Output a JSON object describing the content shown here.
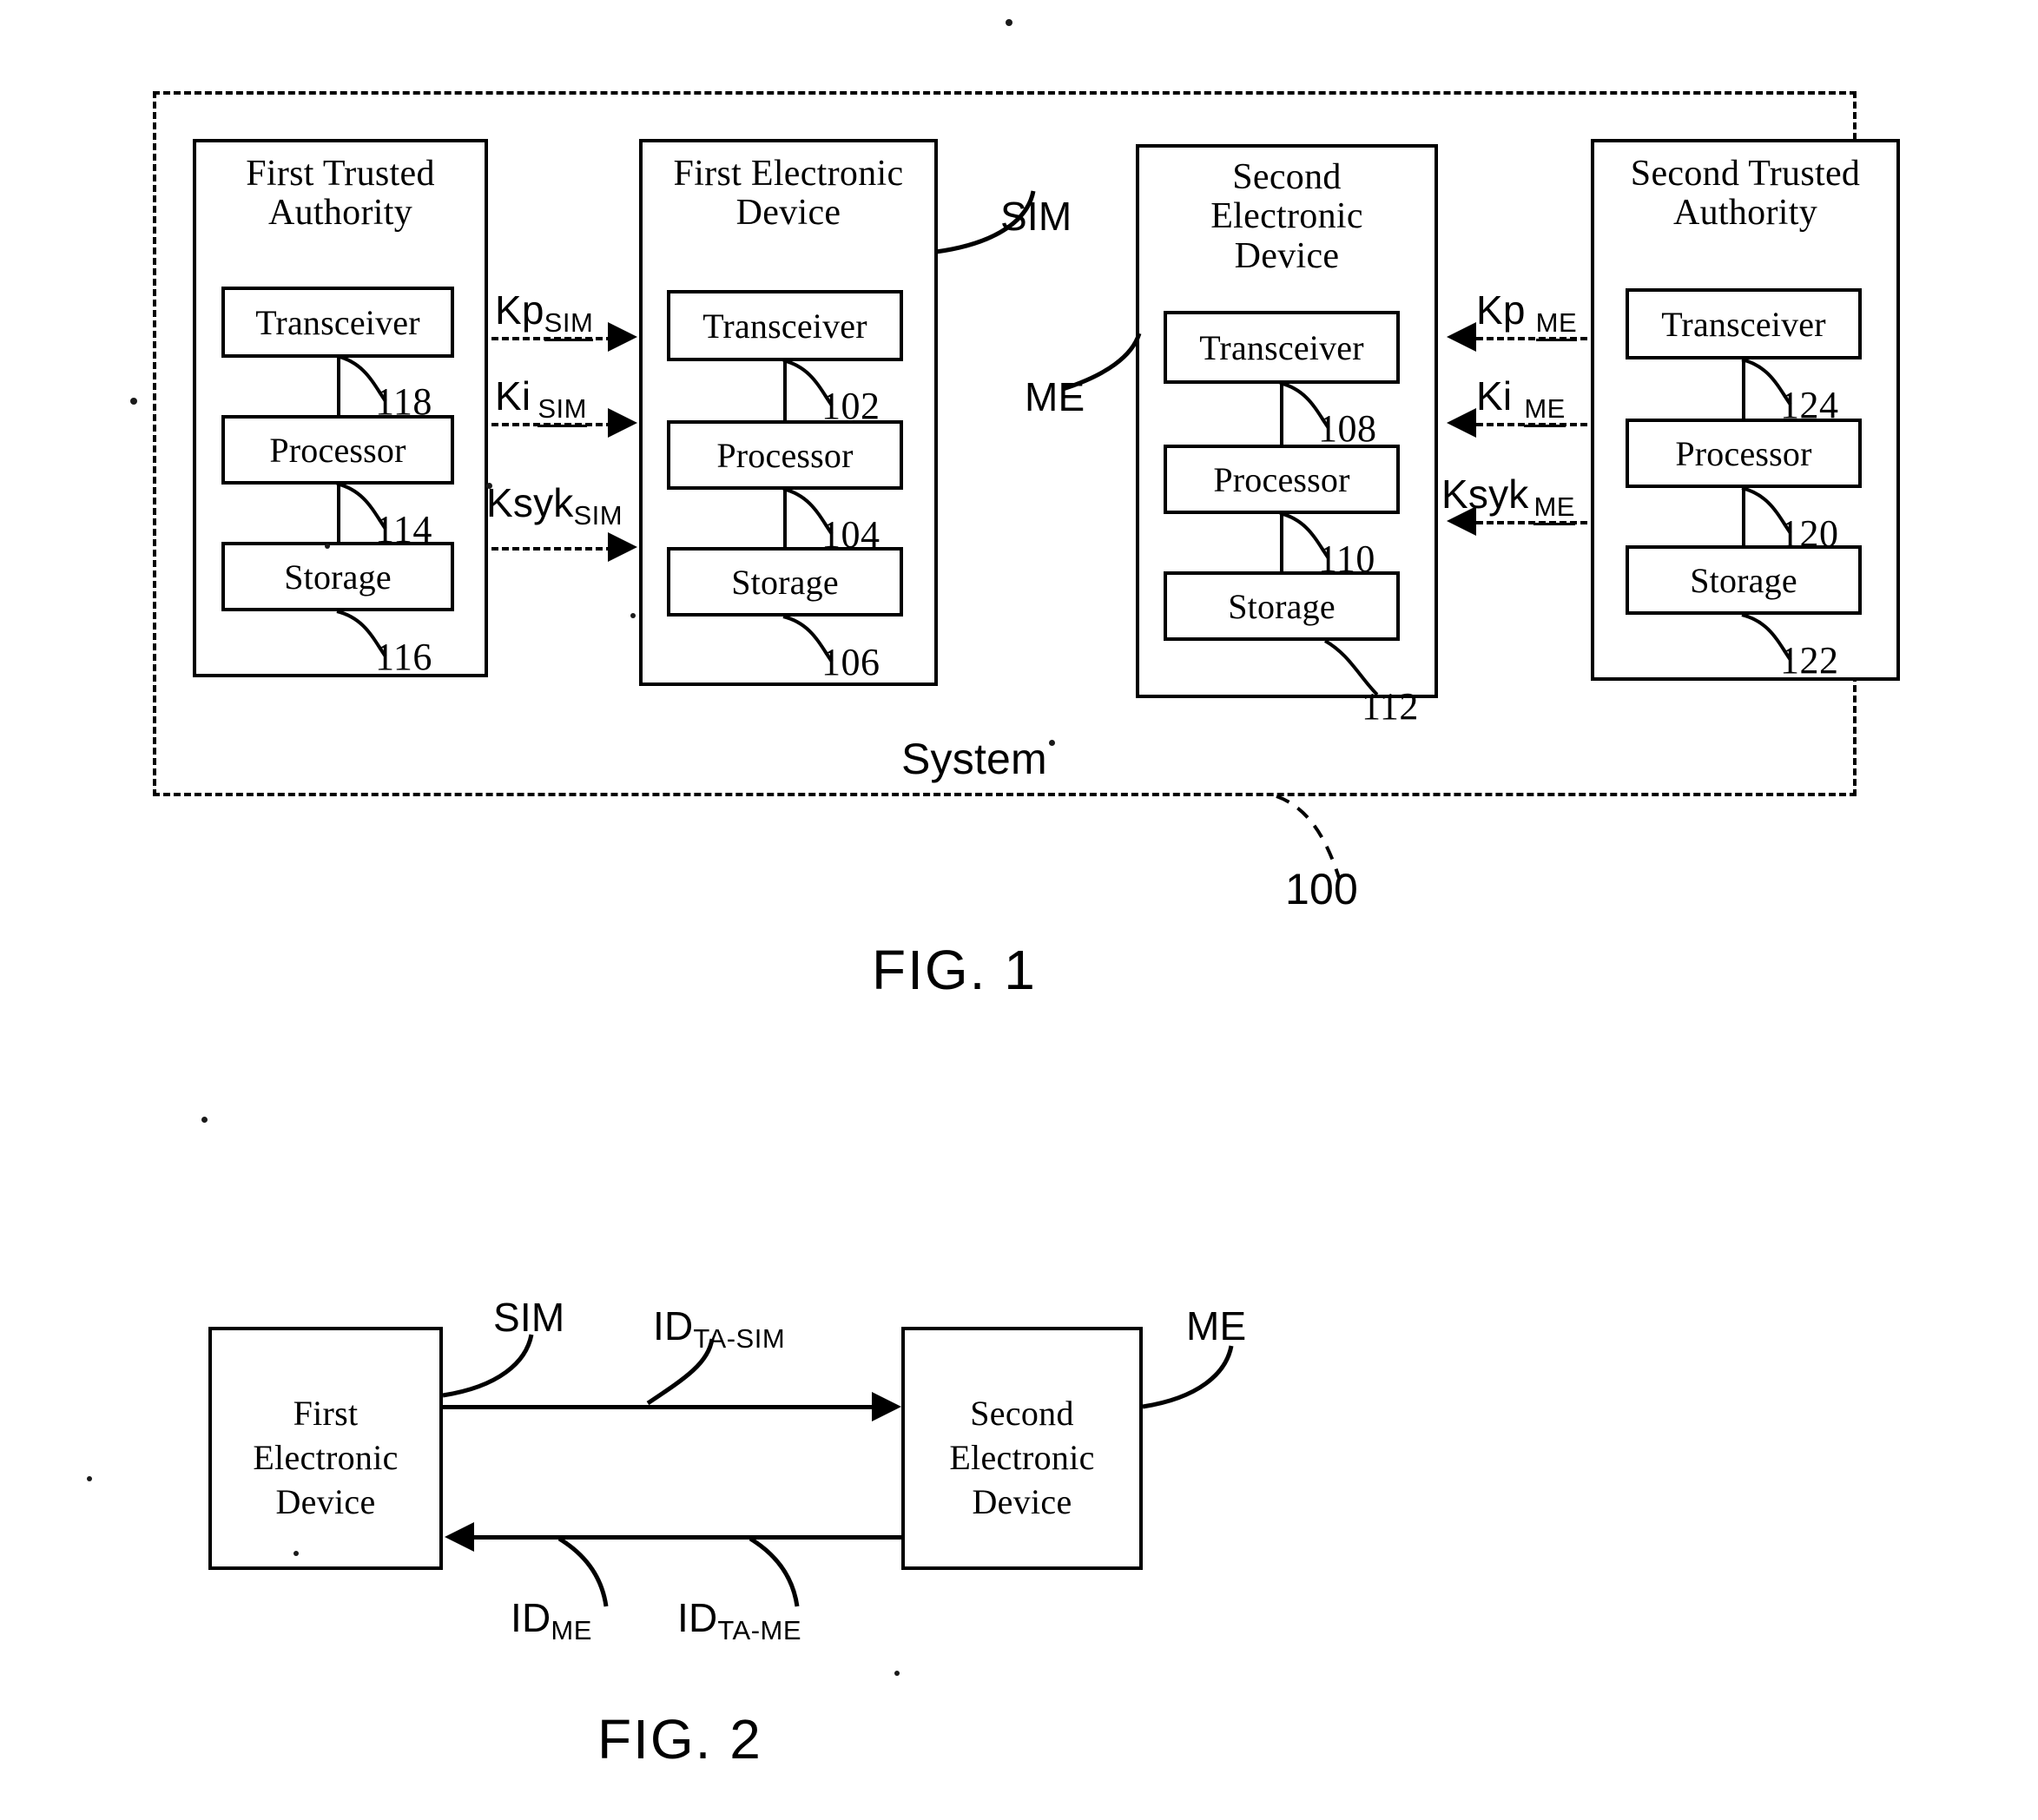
{
  "document": {
    "type": "patent-drawing-sheet",
    "figures": [
      {
        "caption": "FIG. 1",
        "boundary_label": "System",
        "boundary_ref": "100"
      },
      {
        "caption": "FIG. 2"
      }
    ]
  },
  "fig1": {
    "caption": "FIG. 1",
    "system_label": "System",
    "system_ref": "100",
    "entities": [
      {
        "id": "first-trusted-authority",
        "title_line1": "First Trusted",
        "title_line2": "Authority",
        "components": [
          {
            "label": "Transceiver",
            "ref": "118"
          },
          {
            "label": "Processor",
            "ref": "114"
          },
          {
            "label": "Storage",
            "ref": "116"
          }
        ]
      },
      {
        "id": "first-electronic-device",
        "title_line1": "First Electronic",
        "title_line2": "Device",
        "callout": "SIM",
        "components": [
          {
            "label": "Transceiver",
            "ref": "102"
          },
          {
            "label": "Processor",
            "ref": "104"
          },
          {
            "label": "Storage",
            "ref": "106"
          }
        ]
      },
      {
        "id": "second-electronic-device",
        "title_line1": "Second",
        "title_line2": "Electronic",
        "title_line3": "Device",
        "callout": "ME",
        "components": [
          {
            "label": "Transceiver",
            "ref": "108"
          },
          {
            "label": "Processor",
            "ref": "110"
          },
          {
            "label": "Storage",
            "ref": "112"
          }
        ]
      },
      {
        "id": "second-trusted-authority",
        "title_line1": "Second Trusted",
        "title_line2": "Authority",
        "components": [
          {
            "label": "Transceiver",
            "ref": "124"
          },
          {
            "label": "Processor",
            "ref": "120"
          },
          {
            "label": "Storage",
            "ref": "122"
          }
        ]
      }
    ],
    "signals_left": [
      {
        "base": "Kp",
        "sub": "SIM",
        "direction": "right"
      },
      {
        "base": "Ki",
        "sub": "SIM",
        "direction": "right"
      },
      {
        "base": "Ksyk",
        "sub": "SIM",
        "direction": "right"
      }
    ],
    "signals_right": [
      {
        "base": "Kp",
        "sub": "ME",
        "direction": "left"
      },
      {
        "base": "Ki",
        "sub": "ME",
        "direction": "left"
      },
      {
        "base": "Ksyk",
        "sub": "ME",
        "direction": "left"
      }
    ]
  },
  "fig2": {
    "caption": "FIG. 2",
    "left_box": {
      "line1": "First",
      "line2": "Electronic",
      "line3": "Device",
      "callout": "SIM"
    },
    "right_box": {
      "line1": "Second",
      "line2": "Electronic",
      "line3": "Device",
      "callout": "ME"
    },
    "messages": [
      {
        "base": "ID",
        "sub": "TA-SIM",
        "direction": "right"
      },
      {
        "base": "ID",
        "sub": "ME",
        "direction": "left"
      },
      {
        "base": "ID",
        "sub": "TA-ME",
        "direction": "left"
      }
    ]
  }
}
